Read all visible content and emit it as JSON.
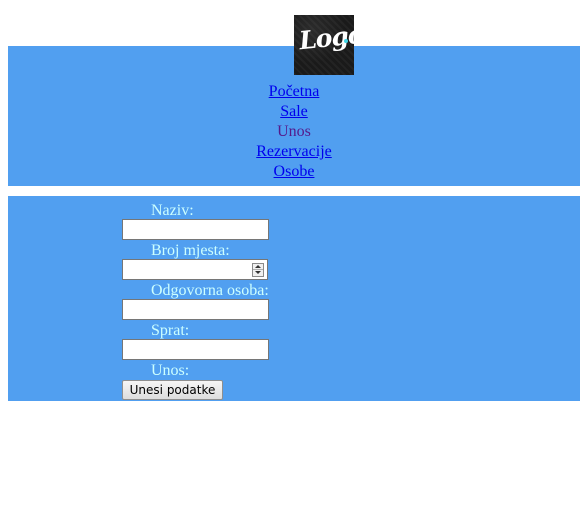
{
  "logo": {
    "text": "Logo",
    "accent_color": "#41d6e8"
  },
  "nav": {
    "items": [
      {
        "label": "Početna",
        "link": true
      },
      {
        "label": "Sale",
        "link": true
      },
      {
        "label": "Unos",
        "link": false,
        "current": true
      },
      {
        "label": "Rezervacije",
        "link": true
      },
      {
        "label": "Osobe",
        "link": true
      }
    ]
  },
  "form": {
    "fields": [
      {
        "label": "Naziv:",
        "value": "",
        "type": "text"
      },
      {
        "label": "Broj mjesta:",
        "value": "",
        "type": "number"
      },
      {
        "label": "Odgovorna osoba:",
        "value": "",
        "type": "text"
      },
      {
        "label": "Sprat:",
        "value": "",
        "type": "text"
      }
    ],
    "submit_label": "Unos:",
    "submit_button": "Unesi podatke"
  },
  "colors": {
    "panel_background": "#519ff0",
    "label_text": "#ccffff",
    "link": "#0000ee",
    "visited": "#551a8b"
  }
}
